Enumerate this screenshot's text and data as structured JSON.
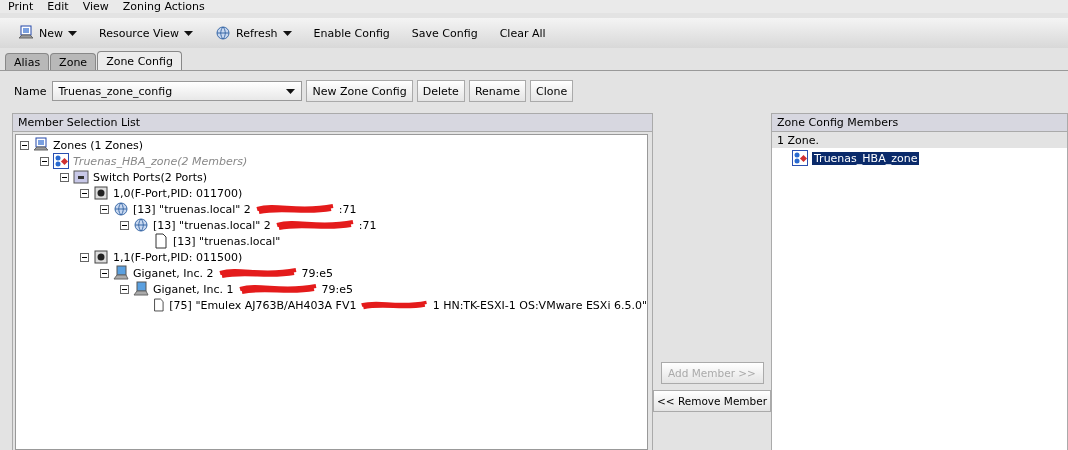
{
  "menu": [
    "Print",
    "Edit",
    "View",
    "Zoning Actions"
  ],
  "toolbar": [
    {
      "label": "New",
      "kind": "new",
      "dropdown": true
    },
    {
      "label": "Resource View",
      "kind": "plain",
      "dropdown": true
    },
    {
      "label": "Refresh",
      "kind": "refresh",
      "dropdown": true
    },
    {
      "label": "Enable Config",
      "kind": "plain",
      "dropdown": false
    },
    {
      "label": "Save Config",
      "kind": "plain",
      "dropdown": false
    },
    {
      "label": "Clear All",
      "kind": "plain",
      "dropdown": false
    }
  ],
  "tabs": [
    {
      "label": "Alias",
      "selected": false
    },
    {
      "label": "Zone",
      "selected": false
    },
    {
      "label": "Zone Config",
      "selected": true
    }
  ],
  "name_row": {
    "label": "Name",
    "value": "Truenas_zone_config",
    "buttons": [
      "New Zone Config",
      "Delete",
      "Rename",
      "Clone"
    ]
  },
  "member_selection": {
    "title": "Member Selection List",
    "tree": [
      {
        "kind": "zones",
        "label": "Zones (1 Zones)",
        "expanded": true,
        "inactive": false,
        "children": [
          {
            "kind": "zone",
            "label": "Truenas_HBA_zone(2 Members)",
            "expanded": true,
            "inactive": true,
            "children": [
              {
                "kind": "switch",
                "label": "Switch Ports(2 Ports)",
                "expanded": true,
                "inactive": false,
                "children": [
                  {
                    "kind": "port",
                    "label": "1,0(F-Port,PID: 011700)",
                    "expanded": true,
                    "inactive": false,
                    "children": [
                      {
                        "kind": "hba",
                        "label": "[13] \"truenas.local\" 2",
                        "suffix": ":71",
                        "expanded": true,
                        "inactive": false,
                        "children": [
                          {
                            "kind": "hba",
                            "label": "[13] \"truenas.local\" 2",
                            "suffix": ":71",
                            "expanded": true,
                            "inactive": false,
                            "children": [
                              {
                                "kind": "file",
                                "label": "[13] \"truenas.local\"",
                                "inactive": false
                              }
                            ]
                          }
                        ]
                      }
                    ]
                  },
                  {
                    "kind": "port",
                    "label": "1,1(F-Port,PID: 011500)",
                    "expanded": true,
                    "inactive": false,
                    "children": [
                      {
                        "kind": "host",
                        "label": "Giganet, Inc. 2",
                        "suffix": "79:e5",
                        "expanded": true,
                        "inactive": false,
                        "children": [
                          {
                            "kind": "host",
                            "label": "Giganet, Inc. 1",
                            "suffix": "79:e5",
                            "expanded": true,
                            "inactive": false,
                            "children": [
                              {
                                "kind": "file",
                                "label": "[75] \"Emulex AJ763B/AH403A FV1",
                                "suffix": "1 HN:TK-ESXI-1 OS:VMware ESXi 6.5.0\"",
                                "inactive": false
                              }
                            ]
                          }
                        ]
                      }
                    ]
                  }
                ]
              }
            ]
          }
        ]
      }
    ]
  },
  "actions": [
    {
      "label": "Add Member >>",
      "disabled": true
    },
    {
      "label": "<< Remove Member",
      "disabled": false
    }
  ],
  "config_members": {
    "title": "Zone Config Members",
    "status": "1 Zone.",
    "items": [
      {
        "label": "Truenas_HBA_zone",
        "selected": true
      }
    ]
  }
}
